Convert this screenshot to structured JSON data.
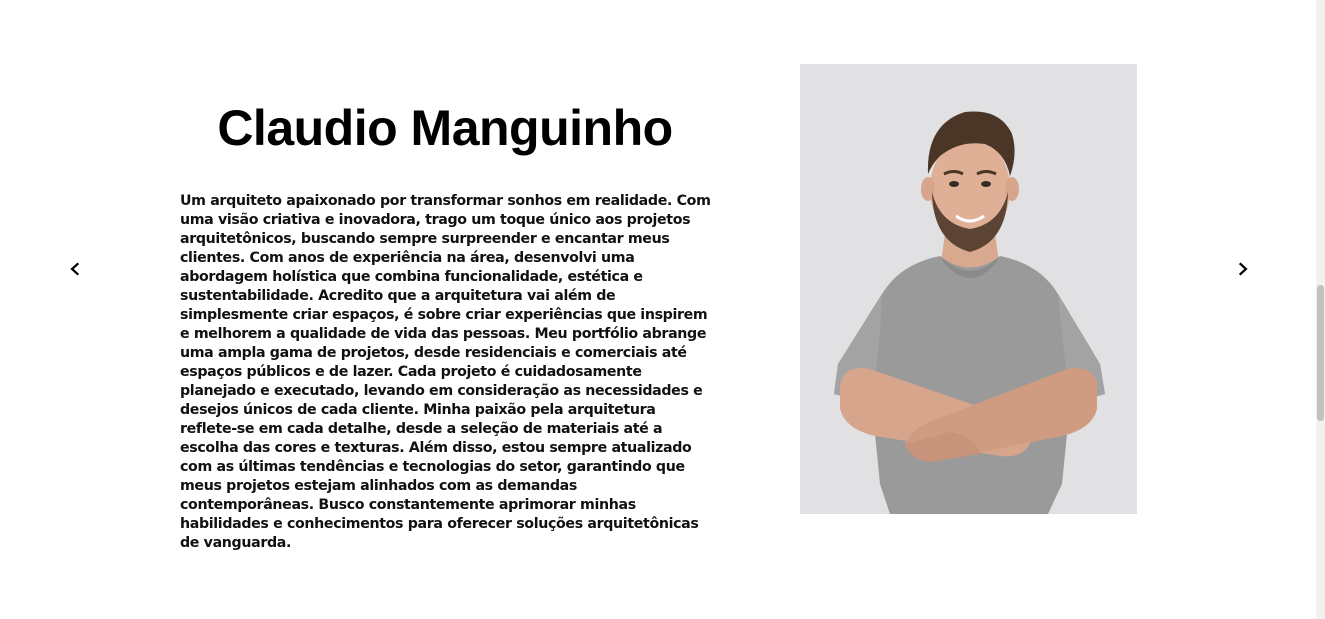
{
  "profile": {
    "name": "Claudio Manguinho",
    "bio": "Um arquiteto apaixonado por transformar sonhos em realidade. Com uma visão criativa e inovadora, trago um toque único aos projetos arquitetônicos, buscando sempre surpreender e encantar meus clientes. Com anos de experiência na área, desenvolvi uma abordagem holística que combina funcionalidade, estética e sustentabilidade. Acredito que a arquitetura vai além de simplesmente criar espaços, é sobre criar experiências que inspirem e melhorem a qualidade de vida das pessoas. Meu portfólio abrange uma ampla gama de projetos, desde residenciais e comerciais até espaços públicos e de lazer. Cada projeto é cuidadosamente planejado e executado, levando em consideração as necessidades e desejos únicos de cada cliente. Minha paixão pela arquitetura reflete-se em cada detalhe, desde a seleção de materiais até a escolha das cores e texturas. Além disso, estou sempre atualizado com as últimas tendências e tecnologias do setor, garantindo que meus projetos estejam alinhados com as demandas contemporâneas. Busco constantemente aprimorar minhas habilidades e conhecimentos para oferecer soluções arquitetônicas de vanguarda."
  },
  "carousel": {
    "prev_icon": "chevron-left-icon",
    "next_icon": "chevron-right-icon"
  },
  "colors": {
    "text": "#000000",
    "photo_background": "#e1e0e2",
    "scrollbar_track": "#f1f1f1",
    "scrollbar_thumb": "#c1c1c1"
  }
}
